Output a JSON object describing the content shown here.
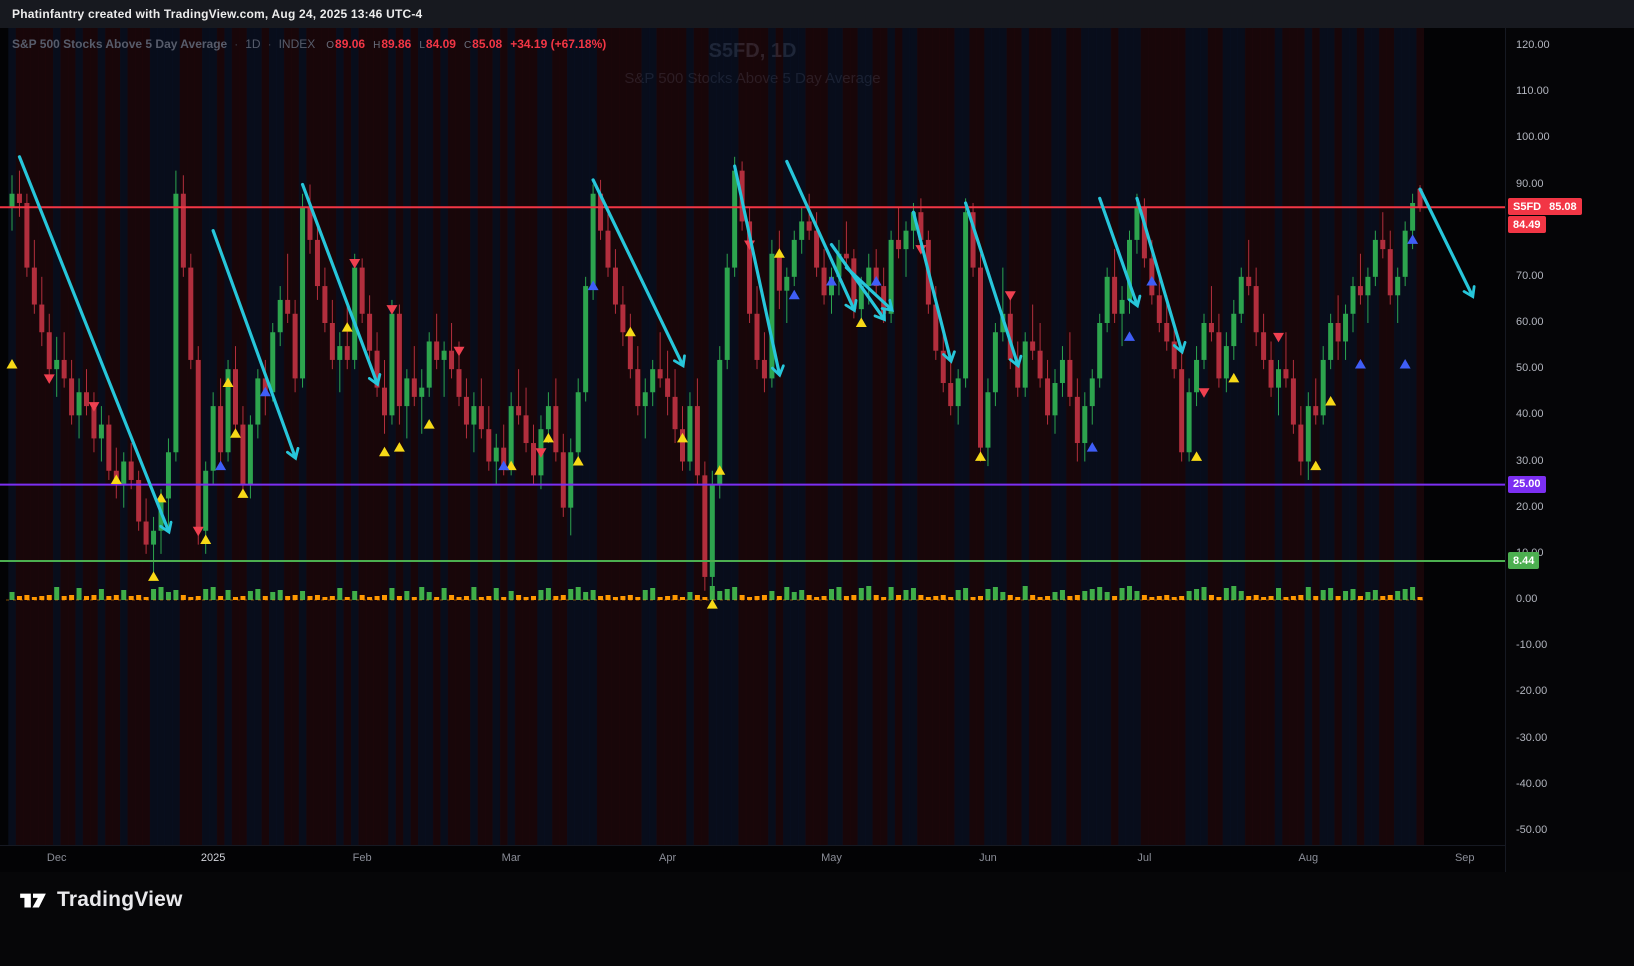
{
  "header": {
    "attribution": "Phatinfantry created with TradingView.com, Aug 24, 2025 13:46 UTC-4"
  },
  "legend": {
    "title": "S&P 500 Stocks Above 5 Day Average",
    "separator": "·",
    "timeframe": "1D",
    "exchange": "INDEX",
    "ohlc": [
      {
        "label": "O",
        "value": "89.06"
      },
      {
        "label": "H",
        "value": "89.86"
      },
      {
        "label": "L",
        "value": "84.09"
      },
      {
        "label": "C",
        "value": "85.08"
      }
    ],
    "change": "+34.19 (+67.18%)"
  },
  "watermark": {
    "line1": "S5FD, 1D",
    "line2": "S&P 500 Stocks Above 5 Day Average"
  },
  "price_axis": {
    "tags": [
      {
        "label": "S5FD",
        "text": "85.08",
        "price": 85.08,
        "color": "#f23645"
      },
      {
        "text": "84.49",
        "price": 84.49,
        "color": "#f23645",
        "below_previous": true
      },
      {
        "text": "25.00",
        "price": 25.0,
        "color": "#7c2ff2"
      },
      {
        "text": "8.44",
        "price": 8.44,
        "color": "#4caf50"
      }
    ]
  },
  "footer": {
    "brand": "TradingView"
  },
  "chart_data": {
    "type": "candlestick",
    "title": "S&P 500 Stocks Above 5 Day Average",
    "symbol": "S5FD",
    "timeframe": "1D",
    "exchange": "INDEX",
    "grid": false,
    "ylim": [
      -55,
      125
    ],
    "y_ticks": [
      120,
      110,
      100,
      90,
      80,
      70,
      60,
      50,
      40,
      30,
      20,
      10,
      0,
      -10,
      -20,
      -30,
      -40,
      -50
    ],
    "x_labels": [
      {
        "text": "Dec",
        "index": 6
      },
      {
        "text": "2025",
        "index": 27,
        "major": true
      },
      {
        "text": "Feb",
        "index": 47
      },
      {
        "text": "Mar",
        "index": 67
      },
      {
        "text": "Apr",
        "index": 88
      },
      {
        "text": "May",
        "index": 110
      },
      {
        "text": "Jun",
        "index": 131
      },
      {
        "text": "Jul",
        "index": 152
      },
      {
        "text": "Aug",
        "index": 174
      },
      {
        "text": "Sep",
        "index": 195
      }
    ],
    "last_bar": {
      "open": 89.06,
      "high": 89.86,
      "low": 84.09,
      "close": 85.08,
      "change": "+34.19 (+67.18%)"
    },
    "hlines": [
      {
        "value": 85.08,
        "color": "#f23645",
        "label": "S5FD"
      },
      {
        "value": 25.0,
        "color": "#7c2ff2"
      },
      {
        "value": 8.44,
        "color": "#4caf50"
      }
    ],
    "candles": [
      [
        85,
        92,
        80,
        88
      ],
      [
        88,
        93,
        83,
        86
      ],
      [
        86,
        88,
        70,
        72
      ],
      [
        72,
        78,
        62,
        64
      ],
      [
        64,
        70,
        55,
        58
      ],
      [
        58,
        62,
        48,
        50
      ],
      [
        50,
        57,
        44,
        52
      ],
      [
        52,
        58,
        46,
        48
      ],
      [
        48,
        52,
        38,
        40
      ],
      [
        40,
        48,
        35,
        45
      ],
      [
        45,
        50,
        40,
        42
      ],
      [
        42,
        45,
        32,
        35
      ],
      [
        35,
        42,
        30,
        38
      ],
      [
        38,
        40,
        26,
        28
      ],
      [
        28,
        33,
        22,
        25
      ],
      [
        25,
        32,
        20,
        30
      ],
      [
        30,
        34,
        24,
        26
      ],
      [
        26,
        28,
        15,
        17
      ],
      [
        17,
        22,
        10,
        12
      ],
      [
        12,
        18,
        6,
        15
      ],
      [
        15,
        24,
        10,
        22
      ],
      [
        22,
        35,
        15,
        32
      ],
      [
        32,
        93,
        30,
        88
      ],
      [
        88,
        92,
        70,
        72
      ],
      [
        72,
        75,
        50,
        52
      ],
      [
        52,
        55,
        12,
        15
      ],
      [
        15,
        30,
        10,
        28
      ],
      [
        28,
        45,
        25,
        42
      ],
      [
        42,
        48,
        30,
        32
      ],
      [
        32,
        52,
        30,
        50
      ],
      [
        50,
        55,
        36,
        38
      ],
      [
        38,
        42,
        23,
        25
      ],
      [
        25,
        40,
        22,
        38
      ],
      [
        38,
        50,
        35,
        48
      ],
      [
        48,
        52,
        40,
        45
      ],
      [
        45,
        60,
        43,
        58
      ],
      [
        58,
        68,
        55,
        65
      ],
      [
        65,
        75,
        60,
        62
      ],
      [
        62,
        65,
        45,
        48
      ],
      [
        48,
        88,
        46,
        85
      ],
      [
        85,
        90,
        75,
        78
      ],
      [
        78,
        82,
        65,
        68
      ],
      [
        68,
        72,
        58,
        60
      ],
      [
        60,
        65,
        50,
        52
      ],
      [
        52,
        58,
        45,
        55
      ],
      [
        55,
        64,
        50,
        52
      ],
      [
        52,
        75,
        50,
        72
      ],
      [
        72,
        74,
        60,
        62
      ],
      [
        62,
        66,
        52,
        54
      ],
      [
        54,
        58,
        44,
        46
      ],
      [
        46,
        52,
        36,
        40
      ],
      [
        40,
        65,
        38,
        62
      ],
      [
        62,
        64,
        38,
        42
      ],
      [
        42,
        50,
        35,
        48
      ],
      [
        48,
        55,
        42,
        44
      ],
      [
        44,
        50,
        36,
        46
      ],
      [
        46,
        58,
        44,
        56
      ],
      [
        56,
        62,
        50,
        52
      ],
      [
        52,
        56,
        44,
        54
      ],
      [
        54,
        60,
        48,
        50
      ],
      [
        50,
        56,
        42,
        44
      ],
      [
        44,
        48,
        35,
        38
      ],
      [
        38,
        45,
        32,
        42
      ],
      [
        42,
        48,
        35,
        37
      ],
      [
        37,
        42,
        28,
        30
      ],
      [
        30,
        36,
        25,
        33
      ],
      [
        33,
        38,
        27,
        29
      ],
      [
        29,
        45,
        27,
        42
      ],
      [
        42,
        50,
        38,
        40
      ],
      [
        40,
        46,
        32,
        34
      ],
      [
        34,
        38,
        25,
        27
      ],
      [
        27,
        40,
        24,
        37
      ],
      [
        37,
        45,
        34,
        42
      ],
      [
        42,
        48,
        30,
        32
      ],
      [
        32,
        36,
        18,
        20
      ],
      [
        20,
        35,
        14,
        32
      ],
      [
        32,
        48,
        30,
        45
      ],
      [
        45,
        70,
        43,
        68
      ],
      [
        68,
        90,
        65,
        88
      ],
      [
        88,
        91,
        78,
        80
      ],
      [
        80,
        84,
        70,
        72
      ],
      [
        72,
        76,
        62,
        64
      ],
      [
        64,
        68,
        55,
        58
      ],
      [
        58,
        62,
        48,
        50
      ],
      [
        50,
        55,
        40,
        42
      ],
      [
        42,
        48,
        35,
        45
      ],
      [
        45,
        52,
        42,
        50
      ],
      [
        50,
        58,
        46,
        48
      ],
      [
        48,
        54,
        40,
        44
      ],
      [
        44,
        50,
        34,
        37
      ],
      [
        37,
        42,
        28,
        30
      ],
      [
        30,
        45,
        28,
        42
      ],
      [
        42,
        48,
        25,
        27
      ],
      [
        27,
        30,
        2,
        5
      ],
      [
        5,
        28,
        2,
        25
      ],
      [
        25,
        55,
        22,
        52
      ],
      [
        52,
        75,
        50,
        72
      ],
      [
        72,
        96,
        70,
        93
      ],
      [
        93,
        95,
        80,
        82
      ],
      [
        82,
        85,
        60,
        62
      ],
      [
        62,
        68,
        50,
        52
      ],
      [
        52,
        58,
        45,
        48
      ],
      [
        48,
        78,
        46,
        75
      ],
      [
        75,
        80,
        63,
        67
      ],
      [
        67,
        72,
        60,
        70
      ],
      [
        70,
        80,
        68,
        78
      ],
      [
        78,
        85,
        75,
        82
      ],
      [
        82,
        88,
        78,
        80
      ],
      [
        80,
        84,
        70,
        72
      ],
      [
        72,
        76,
        64,
        66
      ],
      [
        66,
        72,
        62,
        70
      ],
      [
        70,
        78,
        66,
        75
      ],
      [
        75,
        82,
        72,
        74
      ],
      [
        74,
        76,
        61,
        63
      ],
      [
        63,
        70,
        60,
        68
      ],
      [
        68,
        75,
        64,
        72
      ],
      [
        72,
        76,
        66,
        68
      ],
      [
        68,
        72,
        60,
        62
      ],
      [
        62,
        80,
        60,
        78
      ],
      [
        78,
        85,
        74,
        76
      ],
      [
        76,
        82,
        70,
        80
      ],
      [
        80,
        86,
        76,
        84
      ],
      [
        84,
        87,
        76,
        78
      ],
      [
        78,
        80,
        62,
        64
      ],
      [
        64,
        68,
        52,
        54
      ],
      [
        54,
        58,
        45,
        47
      ],
      [
        47,
        52,
        40,
        42
      ],
      [
        42,
        50,
        38,
        48
      ],
      [
        48,
        87,
        46,
        84
      ],
      [
        84,
        86,
        70,
        72
      ],
      [
        72,
        75,
        30,
        33
      ],
      [
        33,
        48,
        29,
        45
      ],
      [
        45,
        60,
        42,
        58
      ],
      [
        58,
        72,
        56,
        62
      ],
      [
        62,
        66,
        50,
        52
      ],
      [
        52,
        56,
        44,
        46
      ],
      [
        46,
        58,
        44,
        56
      ],
      [
        56,
        64,
        52,
        54
      ],
      [
        54,
        60,
        46,
        48
      ],
      [
        48,
        52,
        38,
        40
      ],
      [
        40,
        50,
        36,
        47
      ],
      [
        47,
        55,
        44,
        52
      ],
      [
        52,
        58,
        42,
        44
      ],
      [
        44,
        48,
        30,
        34
      ],
      [
        34,
        45,
        30,
        42
      ],
      [
        42,
        50,
        38,
        48
      ],
      [
        48,
        62,
        46,
        60
      ],
      [
        60,
        72,
        58,
        70
      ],
      [
        70,
        76,
        60,
        62
      ],
      [
        62,
        68,
        55,
        65
      ],
      [
        65,
        80,
        62,
        78
      ],
      [
        78,
        88,
        75,
        85
      ],
      [
        85,
        87,
        72,
        74
      ],
      [
        74,
        78,
        64,
        66
      ],
      [
        66,
        70,
        58,
        60
      ],
      [
        60,
        66,
        54,
        56
      ],
      [
        56,
        60,
        48,
        50
      ],
      [
        50,
        54,
        30,
        32
      ],
      [
        32,
        48,
        30,
        45
      ],
      [
        45,
        55,
        42,
        52
      ],
      [
        52,
        62,
        50,
        60
      ],
      [
        60,
        68,
        56,
        58
      ],
      [
        58,
        62,
        46,
        48
      ],
      [
        48,
        58,
        45,
        55
      ],
      [
        55,
        65,
        52,
        62
      ],
      [
        62,
        72,
        60,
        70
      ],
      [
        70,
        78,
        66,
        68
      ],
      [
        68,
        72,
        55,
        58
      ],
      [
        58,
        62,
        50,
        52
      ],
      [
        52,
        56,
        44,
        46
      ],
      [
        46,
        52,
        40,
        50
      ],
      [
        50,
        58,
        46,
        48
      ],
      [
        48,
        52,
        36,
        38
      ],
      [
        38,
        42,
        27,
        30
      ],
      [
        30,
        45,
        26,
        42
      ],
      [
        42,
        48,
        38,
        40
      ],
      [
        40,
        55,
        38,
        52
      ],
      [
        52,
        62,
        50,
        60
      ],
      [
        60,
        66,
        52,
        56
      ],
      [
        56,
        64,
        52,
        62
      ],
      [
        62,
        70,
        58,
        68
      ],
      [
        68,
        75,
        64,
        66
      ],
      [
        66,
        72,
        60,
        70
      ],
      [
        70,
        80,
        68,
        78
      ],
      [
        78,
        84,
        74,
        76
      ],
      [
        76,
        80,
        64,
        66
      ],
      [
        66,
        72,
        60,
        70
      ],
      [
        70,
        82,
        68,
        80
      ],
      [
        80,
        88,
        76,
        86
      ],
      [
        89.06,
        89.86,
        84.09,
        85.08
      ]
    ],
    "markers": {
      "yellow_up": [
        [
          0,
          51
        ],
        [
          14,
          26
        ],
        [
          19,
          5
        ],
        [
          20,
          22
        ],
        [
          26,
          13
        ],
        [
          29,
          47
        ],
        [
          30,
          36
        ],
        [
          31,
          23
        ],
        [
          45,
          59
        ],
        [
          50,
          32
        ],
        [
          52,
          33
        ],
        [
          56,
          38
        ],
        [
          67,
          29
        ],
        [
          72,
          35
        ],
        [
          76,
          30
        ],
        [
          83,
          58
        ],
        [
          90,
          35
        ],
        [
          94,
          -1
        ],
        [
          95,
          28
        ],
        [
          103,
          75
        ],
        [
          114,
          60
        ],
        [
          130,
          31
        ],
        [
          159,
          31
        ],
        [
          164,
          48
        ],
        [
          175,
          29
        ],
        [
          177,
          43
        ]
      ],
      "blue_up": [
        [
          28,
          29
        ],
        [
          34,
          45
        ],
        [
          66,
          29
        ],
        [
          78,
          68
        ],
        [
          105,
          66
        ],
        [
          110,
          69
        ],
        [
          116,
          69
        ],
        [
          145,
          33
        ],
        [
          150,
          57
        ],
        [
          153,
          69
        ],
        [
          181,
          51
        ],
        [
          187,
          51
        ],
        [
          188,
          78
        ]
      ],
      "red_down": [
        [
          5,
          48
        ],
        [
          11,
          42
        ],
        [
          25,
          15
        ],
        [
          46,
          73
        ],
        [
          51,
          63
        ],
        [
          60,
          54
        ],
        [
          71,
          32
        ],
        [
          99,
          77
        ],
        [
          122,
          76
        ],
        [
          134,
          66
        ],
        [
          160,
          45
        ],
        [
          170,
          57
        ]
      ]
    },
    "arrows": [
      [
        1,
        96,
        21,
        15
      ],
      [
        27,
        80,
        38,
        31
      ],
      [
        39,
        90,
        49,
        47
      ],
      [
        78,
        91,
        90,
        51
      ],
      [
        97,
        94,
        103,
        49
      ],
      [
        104,
        95,
        113,
        63
      ],
      [
        110,
        77,
        117,
        61
      ],
      [
        112,
        72,
        118,
        63
      ],
      [
        121,
        84,
        126,
        52
      ],
      [
        128,
        86,
        135,
        51
      ],
      [
        146,
        87,
        151,
        64
      ],
      [
        151,
        87,
        157,
        54
      ],
      [
        189,
        89,
        196,
        66
      ]
    ],
    "colors": {
      "up": "#2da44e",
      "down": "#b22e3d",
      "vol_up": "#3fae49",
      "vol_down": "#ff9800",
      "marker_yellow": "#f7d917",
      "marker_blue": "#3f5ef7",
      "marker_red": "#ef4050",
      "arrow": "#27c6da",
      "bg_up": "rgba(12,22,46,0.55)",
      "bg_down": "rgba(46,10,14,0.5)"
    }
  }
}
